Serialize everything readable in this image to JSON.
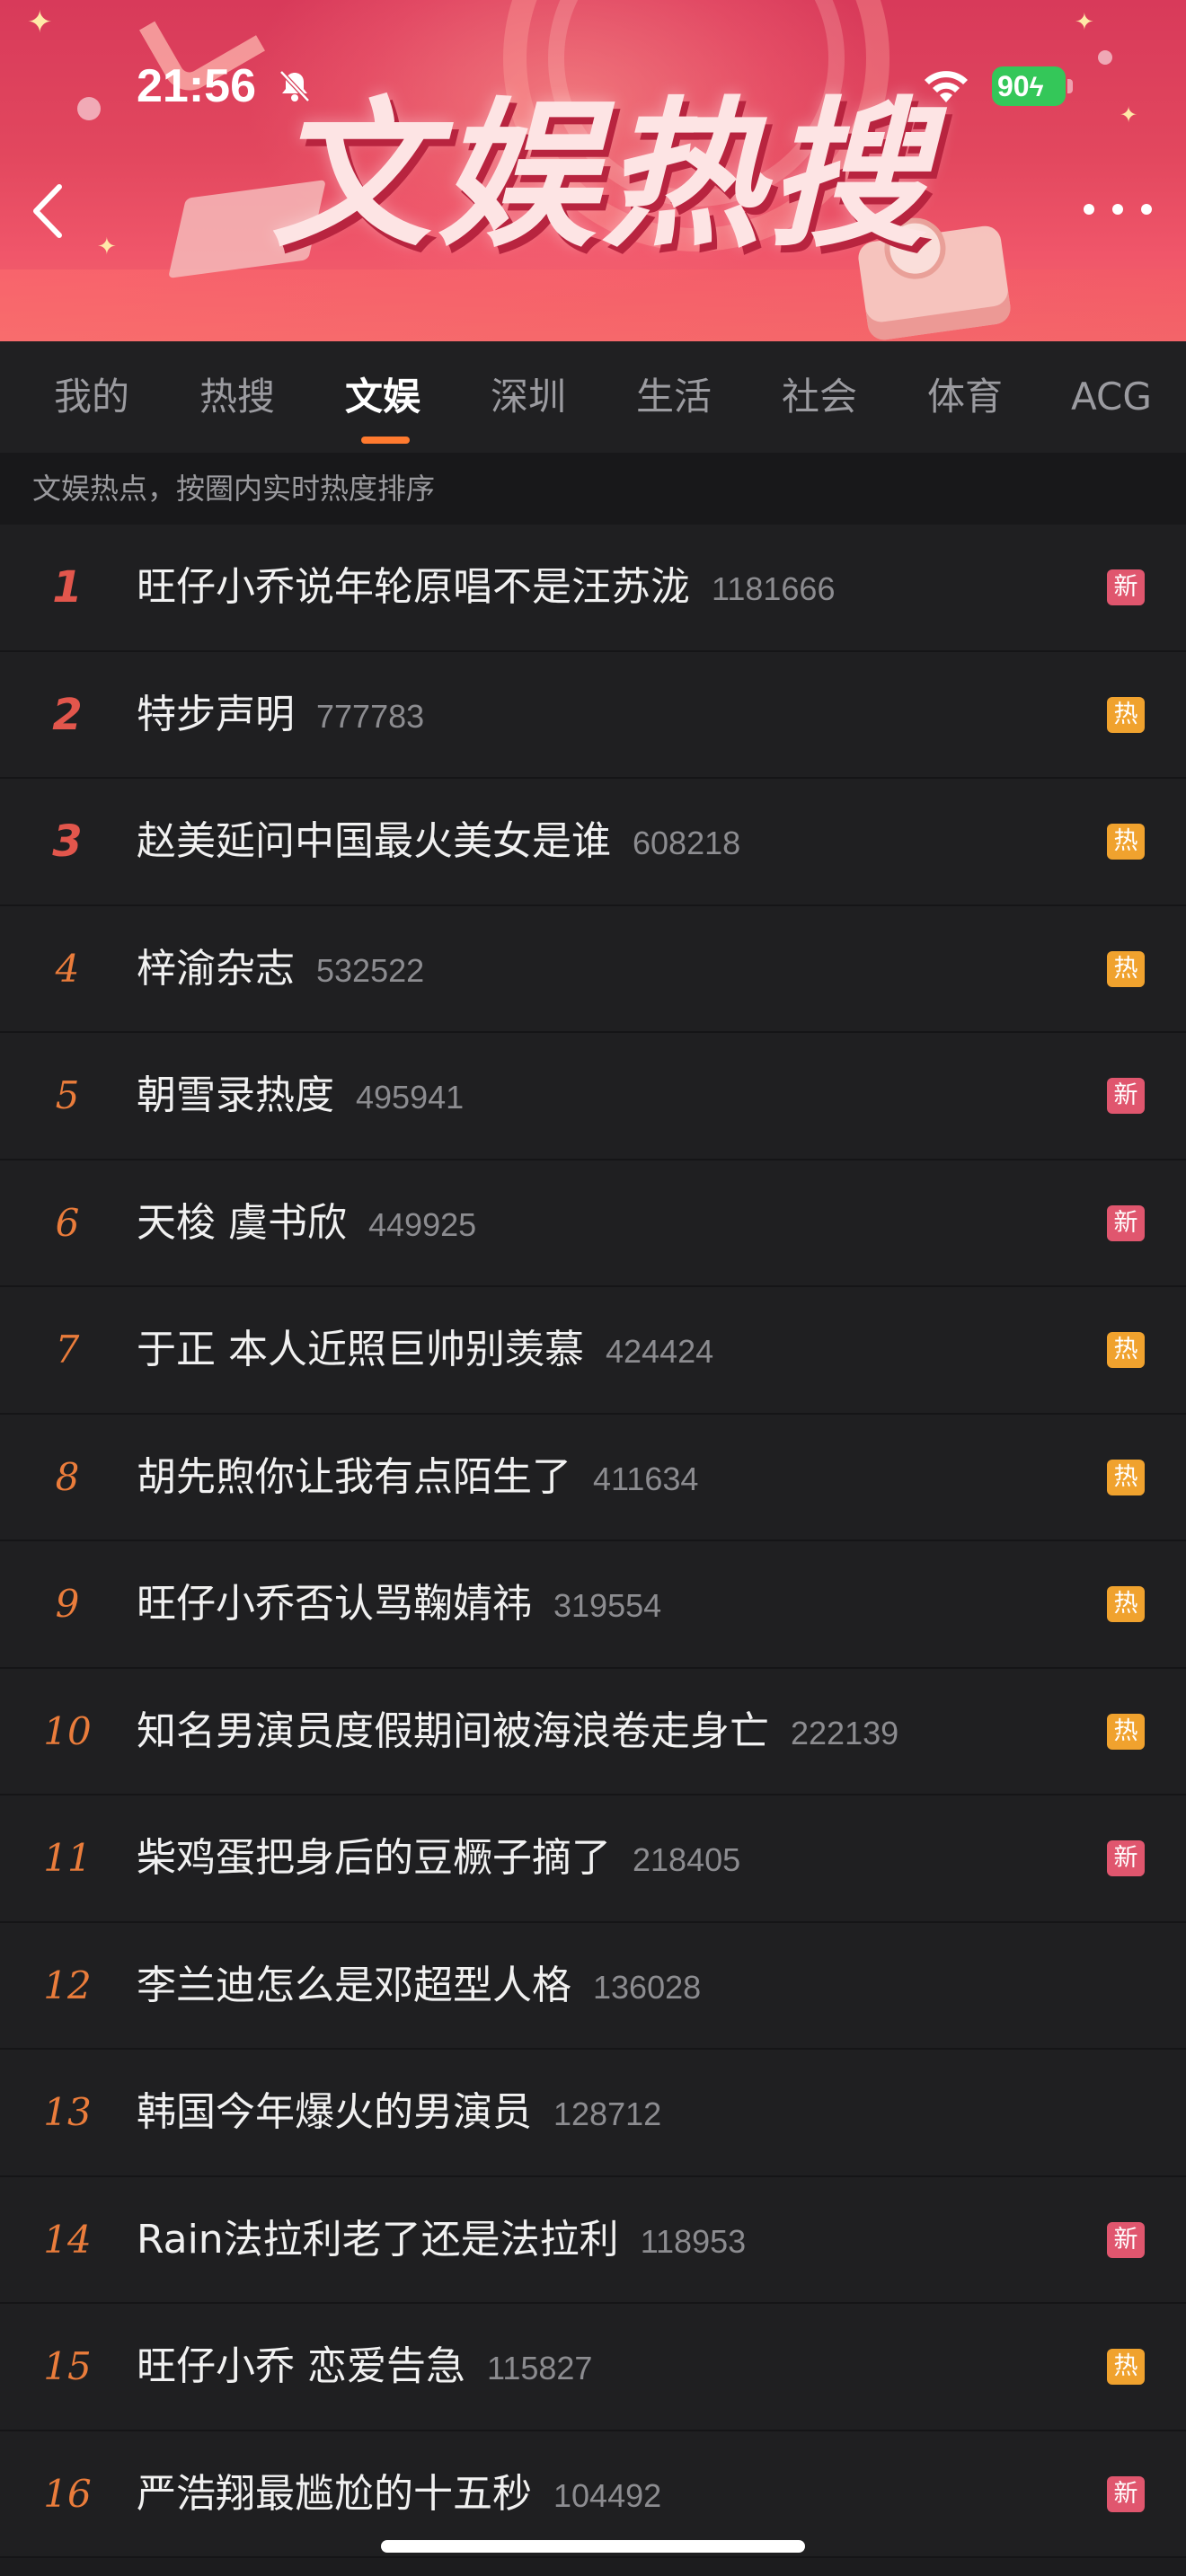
{
  "status_bar": {
    "time": "21:56",
    "battery": "90"
  },
  "banner": {
    "title": "文娱热搜"
  },
  "icons": {
    "back": "back-arrow-icon",
    "more": "more-dots-icon",
    "bell": "bell-slash-icon",
    "wifi": "wifi-icon"
  },
  "tabs": [
    {
      "label": "我的",
      "active": false
    },
    {
      "label": "热搜",
      "active": false
    },
    {
      "label": "文娱",
      "active": true
    },
    {
      "label": "深圳",
      "active": false
    },
    {
      "label": "生活",
      "active": false
    },
    {
      "label": "社会",
      "active": false
    },
    {
      "label": "体育",
      "active": false
    },
    {
      "label": "ACG",
      "active": false
    }
  ],
  "subtitle": "文娱热点，按圈内实时热度排序",
  "colors": {
    "accent": "#ff7a2f",
    "badge_new": "#e0566e",
    "badge_hot": "#f0a22e",
    "rank_top": "#e2564c",
    "rank": "#ea7c3b"
  },
  "list": [
    {
      "rank": "1",
      "title": "旺仔小乔说年轮原唱不是汪苏泷",
      "count": "1181666",
      "badge": "新",
      "badge_type": "new"
    },
    {
      "rank": "2",
      "title": "特步声明",
      "count": "777783",
      "badge": "热",
      "badge_type": "hot"
    },
    {
      "rank": "3",
      "title": "赵美延问中国最火美女是谁",
      "count": "608218",
      "badge": "热",
      "badge_type": "hot"
    },
    {
      "rank": "4",
      "title": "梓渝杂志",
      "count": "532522",
      "badge": "热",
      "badge_type": "hot"
    },
    {
      "rank": "5",
      "title": "朝雪录热度",
      "count": "495941",
      "badge": "新",
      "badge_type": "new"
    },
    {
      "rank": "6",
      "title": "天梭 虞书欣",
      "count": "449925",
      "badge": "新",
      "badge_type": "new"
    },
    {
      "rank": "7",
      "title": "于正 本人近照巨帅别羡慕",
      "count": "424424",
      "badge": "热",
      "badge_type": "hot"
    },
    {
      "rank": "8",
      "title": "胡先煦你让我有点陌生了",
      "count": "411634",
      "badge": "热",
      "badge_type": "hot"
    },
    {
      "rank": "9",
      "title": "旺仔小乔否认骂鞠婧祎",
      "count": "319554",
      "badge": "热",
      "badge_type": "hot"
    },
    {
      "rank": "10",
      "title": "知名男演员度假期间被海浪卷走身亡",
      "count": "222139",
      "badge": "热",
      "badge_type": "hot"
    },
    {
      "rank": "11",
      "title": "柴鸡蛋把身后的豆橛子摘了",
      "count": "218405",
      "badge": "新",
      "badge_type": "new"
    },
    {
      "rank": "12",
      "title": "李兰迪怎么是邓超型人格",
      "count": "136028",
      "badge": "",
      "badge_type": ""
    },
    {
      "rank": "13",
      "title": "韩国今年爆火的男演员",
      "count": "128712",
      "badge": "",
      "badge_type": ""
    },
    {
      "rank": "14",
      "title": "Rain法拉利老了还是法拉利",
      "count": "118953",
      "badge": "新",
      "badge_type": "new"
    },
    {
      "rank": "15",
      "title": "旺仔小乔 恋爱告急",
      "count": "115827",
      "badge": "热",
      "badge_type": "hot"
    },
    {
      "rank": "16",
      "title": "严浩翔最尴尬的十五秒",
      "count": "104492",
      "badge": "新",
      "badge_type": "new"
    }
  ]
}
